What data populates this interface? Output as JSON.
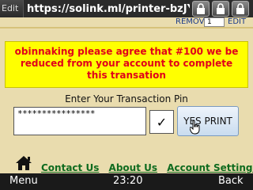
{
  "titlebar": {
    "edit": "Edit",
    "url": "https://solink.ml/printer-bzJYbS..."
  },
  "topbar": {
    "remove": "REMOVE",
    "qty": "1",
    "edit": "EDIT"
  },
  "message": "obinnaking please agree that #100 we be reduced from your account to complete this transation",
  "form": {
    "pin_label": "Enter Your Transaction Pin",
    "pin_value": "****************",
    "checkbox_mark": "✓",
    "print_label": "YES PRINT"
  },
  "links": [
    "Contact Us",
    "About Us",
    "Account Settings"
  ],
  "softkeys": {
    "left": "Menu",
    "time": "23:20",
    "right": "Back"
  },
  "colors": {
    "background": "#e9dcae",
    "message_bg": "#ffff00",
    "message_text": "#e0001a",
    "link_green": "#0f6b1f"
  }
}
